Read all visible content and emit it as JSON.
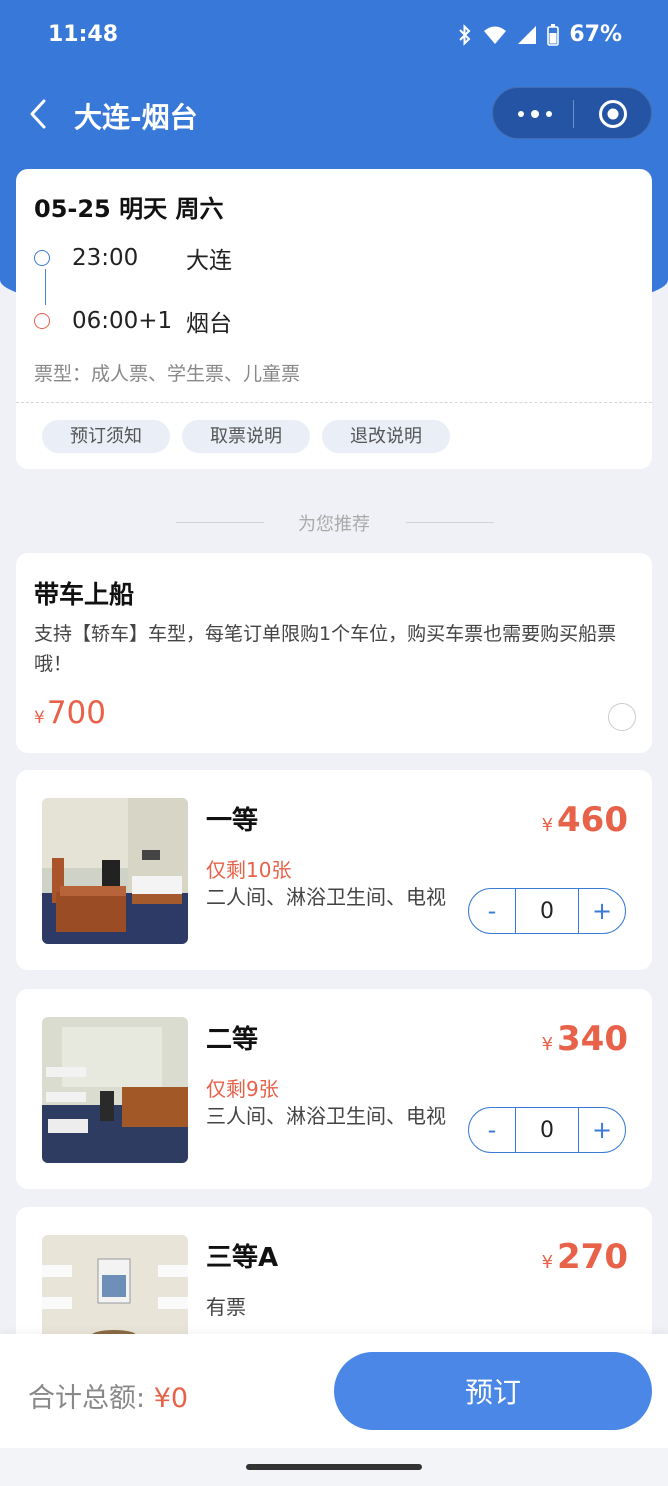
{
  "status_bar": {
    "time": "11:48",
    "battery": "67%"
  },
  "nav": {
    "title": "大连-烟台"
  },
  "trip": {
    "date": "05-25 明天 周六",
    "depart_time": "23:00",
    "depart_port": "大连",
    "arrive_time": "06:00+1",
    "arrive_port": "烟台",
    "ticket_types": "票型：成人票、学生票、儿童票",
    "tags": [
      "预订须知",
      "取票说明",
      "退改说明"
    ]
  },
  "recommend": {
    "title": "为您推荐"
  },
  "car": {
    "title": "带车上船",
    "desc": "支持【轿车】车型，每笔订单限购1个车位，购买车票也需要购买船票哦！",
    "currency": "¥",
    "price": "700"
  },
  "rooms": [
    {
      "name": "一等",
      "remain": "仅剩10张",
      "desc": "二人间、淋浴卫生间、电视",
      "currency": "¥",
      "price": "460",
      "qty": "0",
      "minus": "-",
      "plus": "+"
    },
    {
      "name": "二等",
      "remain": "仅剩9张",
      "desc": "三人间、淋浴卫生间、电视",
      "currency": "¥",
      "price": "340",
      "qty": "0",
      "minus": "-",
      "plus": "+"
    },
    {
      "name": "三等A",
      "stock": "有票",
      "currency": "¥",
      "price": "270"
    }
  ],
  "bottom": {
    "total_label": "合计总额:",
    "total_amount": "¥0",
    "book_label": "预订"
  },
  "colors": {
    "primary": "#3878d8",
    "price": "#e8624a",
    "button": "#4a87e6"
  }
}
